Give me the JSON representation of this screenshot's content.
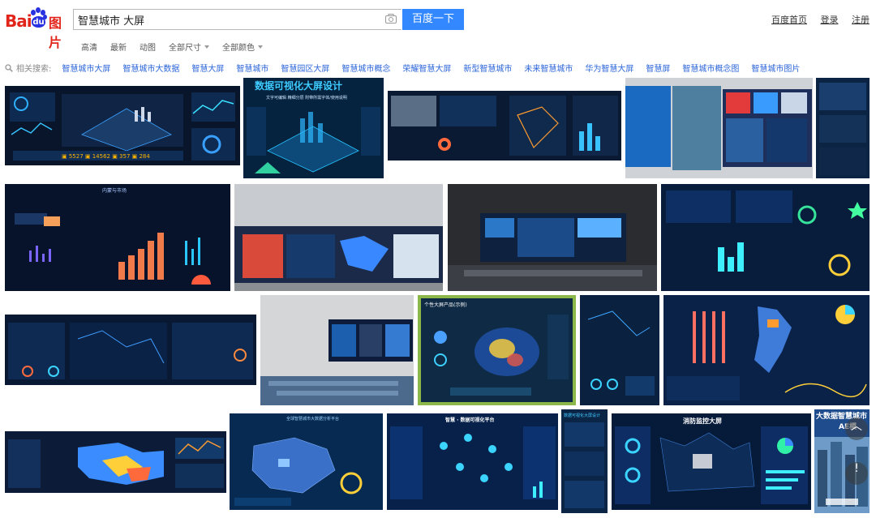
{
  "header": {
    "logo_text": "Bai",
    "logo_paw_text": "du",
    "logo_suffix": "图片",
    "search_value": "智慧城市 大屏",
    "search_button": "百度一下",
    "links": [
      "百度首页",
      "登录",
      "注册"
    ]
  },
  "filters": [
    {
      "label": "高清",
      "dropdown": false
    },
    {
      "label": "最新",
      "dropdown": false
    },
    {
      "label": "动图",
      "dropdown": false
    },
    {
      "label": "全部尺寸",
      "dropdown": true
    },
    {
      "label": "全部颜色",
      "dropdown": true
    }
  ],
  "related": {
    "label": "相关搜索:",
    "items": [
      "智慧城市大屏",
      "智慧城市大数据",
      "智慧大屏",
      "智慧城市",
      "智慧园区大屏",
      "智慧城市概念",
      "荣耀智慧大屏",
      "新型智慧城市",
      "未来智慧城市",
      "华为智慧大屏",
      "智慧屏",
      "智慧城市概念图",
      "智慧城市图片"
    ]
  },
  "thumbnails": [
    {
      "caption": "数据可视化大屏设计",
      "sub": "文字可编辑 精细分层 附带所需字体/使用说明",
      "theme": "dark"
    },
    {
      "caption": "内蒙与市场",
      "sub": "",
      "theme": "dark"
    },
    {
      "caption": "个性大屏产品(示例)",
      "sub": "",
      "theme": "dark"
    },
    {
      "caption": "智慧 · 数据可视化平台",
      "sub": "",
      "theme": "dark"
    },
    {
      "caption": "消防监控大屏",
      "sub": "",
      "theme": "dark"
    },
    {
      "caption": "大数据智慧城市",
      "sub": "AE模",
      "theme": "photo"
    },
    {
      "caption": "全球智慧城市大数据分析平台",
      "sub": "",
      "theme": "dark"
    },
    {
      "caption": "数据可视化大屏设计",
      "sub": "",
      "theme": "dark"
    }
  ],
  "colors": {
    "brand_red": "#e1251b",
    "brand_blue": "#2932e1",
    "button_blue": "#3388ff",
    "link_blue": "#2b65d9"
  },
  "icons": {
    "camera": "camera-icon",
    "search": "magnifier-icon",
    "back_to_top": "chevron-up-icon",
    "feedback": "exclamation-icon"
  }
}
